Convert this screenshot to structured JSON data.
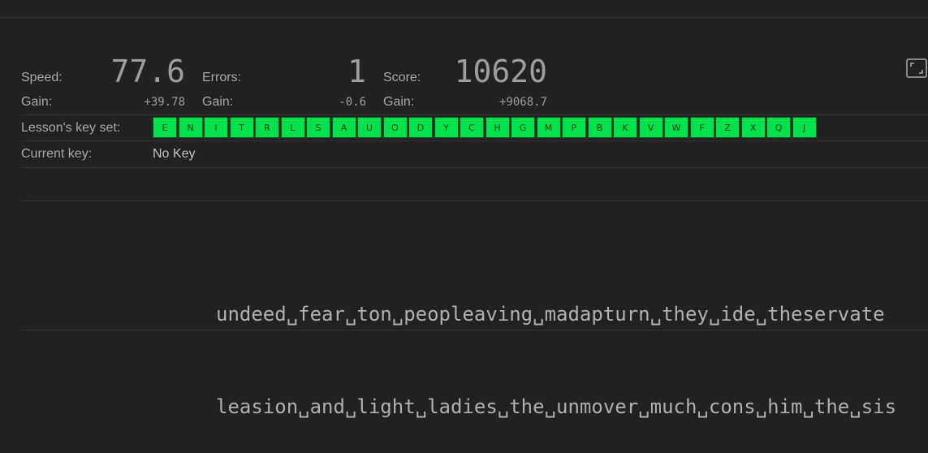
{
  "stats": {
    "speed": {
      "label": "Speed:",
      "value": "77.6",
      "gain_label": "Gain:",
      "gain": "+39.78"
    },
    "errors": {
      "label": "Errors:",
      "value": "1",
      "gain_label": "Gain:",
      "gain": "-0.6"
    },
    "score": {
      "label": "Score:",
      "value": "10620",
      "gain_label": "Gain:",
      "gain": "+9068.7"
    }
  },
  "lesson": {
    "label": "Lesson's key set:",
    "keys": [
      "E",
      "N",
      "I",
      "T",
      "R",
      "L",
      "S",
      "A",
      "U",
      "O",
      "D",
      "Y",
      "C",
      "H",
      "G",
      "M",
      "P",
      "B",
      "K",
      "V",
      "W",
      "F",
      "Z",
      "X",
      "Q",
      "J"
    ],
    "key_color": "#00e24c"
  },
  "current_key": {
    "label": "Current key:",
    "value": "No Key"
  },
  "text": {
    "line1": "undeed␣fear␣ton␣peopleaving␣madapturn␣they␣ide␣theservate",
    "line2": "leasion␣and␣light␣ladies␣the␣unmover␣much␣cons␣him␣the␣sis"
  },
  "icons": {
    "fullscreen": "fullscreen-icon"
  }
}
